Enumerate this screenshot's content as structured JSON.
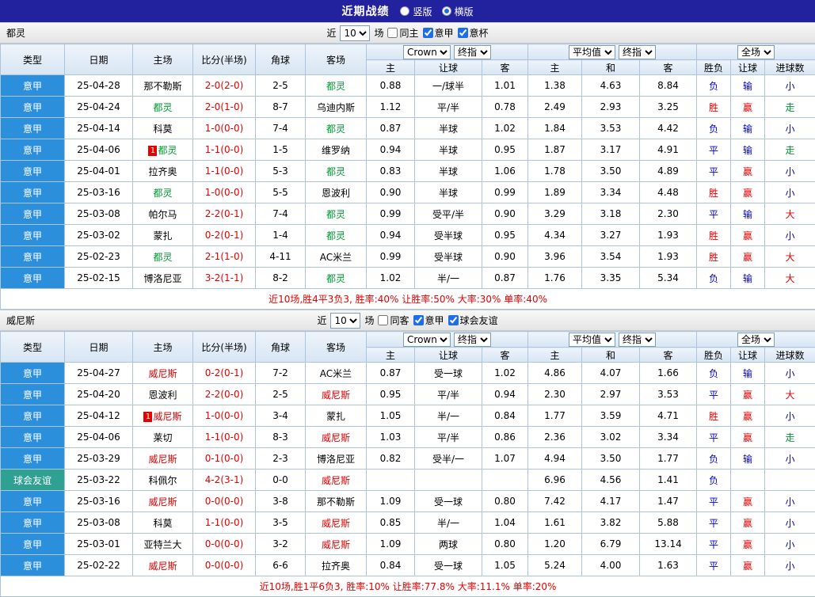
{
  "topbar": {
    "title": "近期战绩",
    "radios": [
      {
        "label": "竖版",
        "selected": false
      },
      {
        "label": "横版",
        "selected": true
      }
    ]
  },
  "labels": {
    "near": "近",
    "games": "场"
  },
  "table_header": {
    "static_cols": [
      "类型",
      "日期",
      "主场",
      "比分(半场)",
      "角球",
      "客场"
    ],
    "odds_group": {
      "selects": [
        "Crown",
        "终指"
      ],
      "cols": [
        "主",
        "让球",
        "客"
      ]
    },
    "avg_group": {
      "selects": [
        "平均值",
        "终指"
      ],
      "cols": [
        "主",
        "和",
        "客"
      ]
    },
    "result_group": {
      "selects": [
        "全场"
      ],
      "cols": [
        "胜负",
        "让球",
        "进球数"
      ]
    }
  },
  "colors": {
    "topbar_bg": "#22229E",
    "grid_border": "#aec4dc",
    "accent_blue": "#1e6ee8",
    "type_map": {
      "意甲": "#2b8fdc",
      "意杯": "#2b8fdc",
      "球会友谊": "#2fa193"
    },
    "code_map": {
      "r": "#e60000",
      "b": "#0000cc",
      "g": "#009933",
      "k": "#000000"
    },
    "score_color": "#e60000",
    "summary_color": "#e60000",
    "badge_bg": "#e60000"
  },
  "sections": [
    {
      "team": "都灵",
      "filter": {
        "count": "10",
        "checks": [
          {
            "label": "同主",
            "checked": false
          },
          {
            "label": "意甲",
            "checked": true
          },
          {
            "label": "意杯",
            "checked": true
          }
        ]
      },
      "rows": [
        {
          "league": "意甲",
          "date": "25-04-28",
          "home": "那不勒斯",
          "homeColor": "k",
          "homeCard": "",
          "score": "2-0(2-0)",
          "corners": "2-5",
          "away": "都灵",
          "awayColor": "g",
          "awayCard": "",
          "odds": [
            "0.88",
            "一/球半",
            "1.01"
          ],
          "avg": [
            "1.38",
            "4.63",
            "8.84"
          ],
          "results": [
            [
              "负",
              "b"
            ],
            [
              "输",
              "b"
            ],
            [
              "小",
              "b"
            ]
          ]
        },
        {
          "league": "意甲",
          "date": "25-04-24",
          "home": "都灵",
          "homeColor": "g",
          "homeCard": "",
          "score": "2-0(1-0)",
          "corners": "8-7",
          "away": "乌迪内斯",
          "awayColor": "k",
          "awayCard": "",
          "odds": [
            "1.12",
            "平/半",
            "0.78"
          ],
          "avg": [
            "2.49",
            "2.93",
            "3.25"
          ],
          "results": [
            [
              "胜",
              "r"
            ],
            [
              "赢",
              "r"
            ],
            [
              "走",
              "g"
            ]
          ]
        },
        {
          "league": "意甲",
          "date": "25-04-14",
          "home": "科莫",
          "homeColor": "k",
          "homeCard": "",
          "score": "1-0(0-0)",
          "corners": "7-4",
          "away": "都灵",
          "awayColor": "g",
          "awayCard": "",
          "odds": [
            "0.87",
            "半球",
            "1.02"
          ],
          "avg": [
            "1.84",
            "3.53",
            "4.42"
          ],
          "results": [
            [
              "负",
              "b"
            ],
            [
              "输",
              "b"
            ],
            [
              "小",
              "b"
            ]
          ]
        },
        {
          "league": "意甲",
          "date": "25-04-06",
          "home": "都灵",
          "homeColor": "g",
          "homeCard": "1",
          "score": "1-1(0-0)",
          "corners": "1-5",
          "away": "维罗纳",
          "awayColor": "k",
          "awayCard": "",
          "odds": [
            "0.94",
            "半球",
            "0.95"
          ],
          "avg": [
            "1.87",
            "3.17",
            "4.91"
          ],
          "results": [
            [
              "平",
              "b"
            ],
            [
              "输",
              "b"
            ],
            [
              "走",
              "g"
            ]
          ]
        },
        {
          "league": "意甲",
          "date": "25-04-01",
          "home": "拉齐奥",
          "homeColor": "k",
          "homeCard": "",
          "score": "1-1(0-0)",
          "corners": "5-3",
          "away": "都灵",
          "awayColor": "g",
          "awayCard": "",
          "odds": [
            "0.83",
            "半球",
            "1.06"
          ],
          "avg": [
            "1.78",
            "3.50",
            "4.89"
          ],
          "results": [
            [
              "平",
              "b"
            ],
            [
              "赢",
              "r"
            ],
            [
              "小",
              "b"
            ]
          ]
        },
        {
          "league": "意甲",
          "date": "25-03-16",
          "home": "都灵",
          "homeColor": "g",
          "homeCard": "",
          "score": "1-0(0-0)",
          "corners": "5-5",
          "away": "恩波利",
          "awayColor": "k",
          "awayCard": "",
          "odds": [
            "0.90",
            "半球",
            "0.99"
          ],
          "avg": [
            "1.89",
            "3.34",
            "4.48"
          ],
          "results": [
            [
              "胜",
              "r"
            ],
            [
              "赢",
              "r"
            ],
            [
              "小",
              "b"
            ]
          ]
        },
        {
          "league": "意甲",
          "date": "25-03-08",
          "home": "帕尔马",
          "homeColor": "k",
          "homeCard": "",
          "score": "2-2(0-1)",
          "corners": "7-4",
          "away": "都灵",
          "awayColor": "g",
          "awayCard": "",
          "odds": [
            "0.99",
            "受平/半",
            "0.90"
          ],
          "avg": [
            "3.29",
            "3.18",
            "2.30"
          ],
          "results": [
            [
              "平",
              "b"
            ],
            [
              "输",
              "b"
            ],
            [
              "大",
              "r"
            ]
          ]
        },
        {
          "league": "意甲",
          "date": "25-03-02",
          "home": "蒙扎",
          "homeColor": "k",
          "homeCard": "",
          "score": "0-2(0-1)",
          "corners": "1-4",
          "away": "都灵",
          "awayColor": "g",
          "awayCard": "",
          "odds": [
            "0.94",
            "受半球",
            "0.95"
          ],
          "avg": [
            "4.34",
            "3.27",
            "1.93"
          ],
          "results": [
            [
              "胜",
              "r"
            ],
            [
              "赢",
              "r"
            ],
            [
              "小",
              "b"
            ]
          ]
        },
        {
          "league": "意甲",
          "date": "25-02-23",
          "home": "都灵",
          "homeColor": "g",
          "homeCard": "",
          "score": "2-1(1-0)",
          "corners": "4-11",
          "away": "AC米兰",
          "awayColor": "k",
          "awayCard": "",
          "odds": [
            "0.99",
            "受半球",
            "0.90"
          ],
          "avg": [
            "3.96",
            "3.54",
            "1.93"
          ],
          "results": [
            [
              "胜",
              "r"
            ],
            [
              "赢",
              "r"
            ],
            [
              "大",
              "r"
            ]
          ]
        },
        {
          "league": "意甲",
          "date": "25-02-15",
          "home": "博洛尼亚",
          "homeColor": "k",
          "homeCard": "",
          "score": "3-2(1-1)",
          "corners": "8-2",
          "away": "都灵",
          "awayColor": "g",
          "awayCard": "",
          "odds": [
            "1.02",
            "半/一",
            "0.87"
          ],
          "avg": [
            "1.76",
            "3.35",
            "5.34"
          ],
          "results": [
            [
              "负",
              "b"
            ],
            [
              "输",
              "b"
            ],
            [
              "大",
              "r"
            ]
          ]
        }
      ],
      "summary": "近10场,胜4平3负3, 胜率:40% 让胜率:50% 大率:30% 单率:40%"
    },
    {
      "team": "威尼斯",
      "filter": {
        "count": "10",
        "checks": [
          {
            "label": "同客",
            "checked": false
          },
          {
            "label": "意甲",
            "checked": true
          },
          {
            "label": "球会友谊",
            "checked": true
          }
        ]
      },
      "rows": [
        {
          "league": "意甲",
          "date": "25-04-27",
          "home": "威尼斯",
          "homeColor": "r",
          "homeCard": "",
          "score": "0-2(0-1)",
          "corners": "7-2",
          "away": "AC米兰",
          "awayColor": "k",
          "awayCard": "",
          "odds": [
            "0.87",
            "受一球",
            "1.02"
          ],
          "avg": [
            "4.86",
            "4.07",
            "1.66"
          ],
          "results": [
            [
              "负",
              "b"
            ],
            [
              "输",
              "b"
            ],
            [
              "小",
              "b"
            ]
          ]
        },
        {
          "league": "意甲",
          "date": "25-04-20",
          "home": "恩波利",
          "homeColor": "k",
          "homeCard": "",
          "score": "2-2(0-0)",
          "corners": "2-5",
          "away": "威尼斯",
          "awayColor": "r",
          "awayCard": "",
          "odds": [
            "0.95",
            "平/半",
            "0.94"
          ],
          "avg": [
            "2.30",
            "2.97",
            "3.53"
          ],
          "results": [
            [
              "平",
              "b"
            ],
            [
              "赢",
              "r"
            ],
            [
              "大",
              "r"
            ]
          ]
        },
        {
          "league": "意甲",
          "date": "25-04-12",
          "home": "威尼斯",
          "homeColor": "r",
          "homeCard": "1",
          "score": "1-0(0-0)",
          "corners": "3-4",
          "away": "蒙扎",
          "awayColor": "k",
          "awayCard": "",
          "odds": [
            "1.05",
            "半/一",
            "0.84"
          ],
          "avg": [
            "1.77",
            "3.59",
            "4.71"
          ],
          "results": [
            [
              "胜",
              "r"
            ],
            [
              "赢",
              "r"
            ],
            [
              "小",
              "b"
            ]
          ]
        },
        {
          "league": "意甲",
          "date": "25-04-06",
          "home": "莱切",
          "homeColor": "k",
          "homeCard": "",
          "score": "1-1(0-0)",
          "corners": "8-3",
          "away": "威尼斯",
          "awayColor": "r",
          "awayCard": "",
          "odds": [
            "1.03",
            "平/半",
            "0.86"
          ],
          "avg": [
            "2.36",
            "3.02",
            "3.34"
          ],
          "results": [
            [
              "平",
              "b"
            ],
            [
              "赢",
              "r"
            ],
            [
              "走",
              "g"
            ]
          ]
        },
        {
          "league": "意甲",
          "date": "25-03-29",
          "home": "威尼斯",
          "homeColor": "r",
          "homeCard": "",
          "score": "0-1(0-0)",
          "corners": "2-3",
          "away": "博洛尼亚",
          "awayColor": "k",
          "awayCard": "",
          "odds": [
            "0.82",
            "受半/一",
            "1.07"
          ],
          "avg": [
            "4.94",
            "3.50",
            "1.77"
          ],
          "results": [
            [
              "负",
              "b"
            ],
            [
              "输",
              "b"
            ],
            [
              "小",
              "b"
            ]
          ]
        },
        {
          "league": "球会友谊",
          "date": "25-03-22",
          "home": "科佩尔",
          "homeColor": "k",
          "homeCard": "",
          "score": "4-2(3-1)",
          "corners": "0-0",
          "away": "威尼斯",
          "awayColor": "r",
          "awayCard": "",
          "odds": [
            "",
            "",
            ""
          ],
          "avg": [
            "6.96",
            "4.56",
            "1.41"
          ],
          "results": [
            [
              "负",
              "b"
            ],
            [
              "",
              ""
            ],
            [
              "",
              ""
            ]
          ]
        },
        {
          "league": "意甲",
          "date": "25-03-16",
          "home": "威尼斯",
          "homeColor": "r",
          "homeCard": "",
          "score": "0-0(0-0)",
          "corners": "3-8",
          "away": "那不勒斯",
          "awayColor": "k",
          "awayCard": "",
          "odds": [
            "1.09",
            "受一球",
            "0.80"
          ],
          "avg": [
            "7.42",
            "4.17",
            "1.47"
          ],
          "results": [
            [
              "平",
              "b"
            ],
            [
              "赢",
              "r"
            ],
            [
              "小",
              "b"
            ]
          ]
        },
        {
          "league": "意甲",
          "date": "25-03-08",
          "home": "科莫",
          "homeColor": "k",
          "homeCard": "",
          "score": "1-1(0-0)",
          "corners": "3-5",
          "away": "威尼斯",
          "awayColor": "r",
          "awayCard": "",
          "odds": [
            "0.85",
            "半/一",
            "1.04"
          ],
          "avg": [
            "1.61",
            "3.82",
            "5.88"
          ],
          "results": [
            [
              "平",
              "b"
            ],
            [
              "赢",
              "r"
            ],
            [
              "小",
              "b"
            ]
          ]
        },
        {
          "league": "意甲",
          "date": "25-03-01",
          "home": "亚特兰大",
          "homeColor": "k",
          "homeCard": "",
          "score": "0-0(0-0)",
          "corners": "3-2",
          "away": "威尼斯",
          "awayColor": "r",
          "awayCard": "",
          "odds": [
            "1.09",
            "两球",
            "0.80"
          ],
          "avg": [
            "1.20",
            "6.79",
            "13.14"
          ],
          "results": [
            [
              "平",
              "b"
            ],
            [
              "赢",
              "r"
            ],
            [
              "小",
              "b"
            ]
          ]
        },
        {
          "league": "意甲",
          "date": "25-02-22",
          "home": "威尼斯",
          "homeColor": "r",
          "homeCard": "",
          "score": "0-0(0-0)",
          "corners": "6-6",
          "away": "拉齐奥",
          "awayColor": "k",
          "awayCard": "",
          "odds": [
            "0.84",
            "受一球",
            "1.05"
          ],
          "avg": [
            "5.24",
            "4.00",
            "1.63"
          ],
          "results": [
            [
              "平",
              "b"
            ],
            [
              "赢",
              "r"
            ],
            [
              "小",
              "b"
            ]
          ]
        }
      ],
      "summary": "近10场,胜1平6负3, 胜率:10% 让胜率:77.8% 大率:11.1% 单率:20%"
    }
  ]
}
